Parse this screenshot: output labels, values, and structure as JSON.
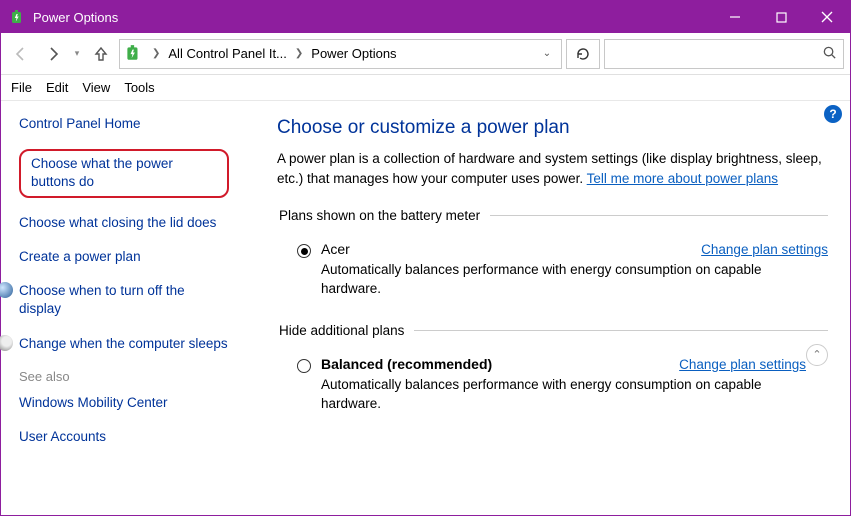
{
  "titlebar": {
    "title": "Power Options"
  },
  "breadcrumb": {
    "seg1": "All Control Panel It...",
    "seg2": "Power Options"
  },
  "menu": {
    "file": "File",
    "edit": "Edit",
    "view": "View",
    "tools": "Tools"
  },
  "sidebar": {
    "home": "Control Panel Home",
    "power_buttons": "Choose what the power buttons do",
    "closing_lid": "Choose what closing the lid does",
    "create_plan": "Create a power plan",
    "turn_off_display": "Choose when to turn off the display",
    "computer_sleeps": "Change when the computer sleeps",
    "see_also": "See also",
    "mobility": "Windows Mobility Center",
    "user_accounts": "User Accounts"
  },
  "main": {
    "heading": "Choose or customize a power plan",
    "desc_pre": "A power plan is a collection of hardware and system settings (like display brightness, sleep, etc.) that manages how your computer uses power. ",
    "desc_link": "Tell me more about power plans",
    "group1_legend": "Plans shown on the battery meter",
    "plan1_name": "Acer",
    "plan1_change": "Change plan settings",
    "plan1_desc": "Automatically balances performance with energy consumption on capable hardware.",
    "group2_legend": "Hide additional plans",
    "plan2_name": "Balanced (recommended)",
    "plan2_change": "Change plan settings",
    "plan2_desc": "Automatically balances performance with energy consumption on capable hardware."
  },
  "search": {
    "placeholder": ""
  }
}
